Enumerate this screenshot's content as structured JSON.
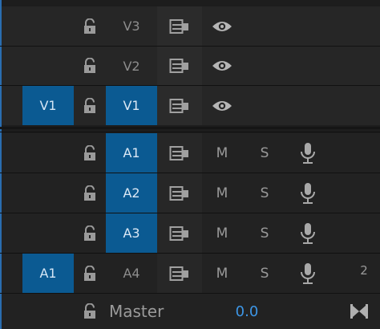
{
  "video_tracks": [
    {
      "source": "",
      "source_active": false,
      "target": "V3",
      "target_active": false
    },
    {
      "source": "",
      "source_active": false,
      "target": "V2",
      "target_active": false
    },
    {
      "source": "V1",
      "source_active": true,
      "target": "V1",
      "target_active": true
    }
  ],
  "audio_tracks": [
    {
      "source": "",
      "source_active": false,
      "target": "A1",
      "target_active": true,
      "mute": "M",
      "solo": "S",
      "badge": ""
    },
    {
      "source": "",
      "source_active": false,
      "target": "A2",
      "target_active": true,
      "mute": "M",
      "solo": "S",
      "badge": ""
    },
    {
      "source": "",
      "source_active": false,
      "target": "A3",
      "target_active": true,
      "mute": "M",
      "solo": "S",
      "badge": ""
    },
    {
      "source": "A1",
      "source_active": true,
      "target": "A4",
      "target_active": false,
      "mute": "M",
      "solo": "S",
      "badge": "2"
    }
  ],
  "master": {
    "label": "Master",
    "value": "0.0"
  },
  "colors": {
    "accent": "#0b5a92",
    "value_blue": "#3d96e6",
    "panel_bg": "#1d1d1d"
  },
  "icons": [
    "lock-icon",
    "sync-lock-icon",
    "eye-icon",
    "microphone-icon",
    "bowtie-icon"
  ]
}
